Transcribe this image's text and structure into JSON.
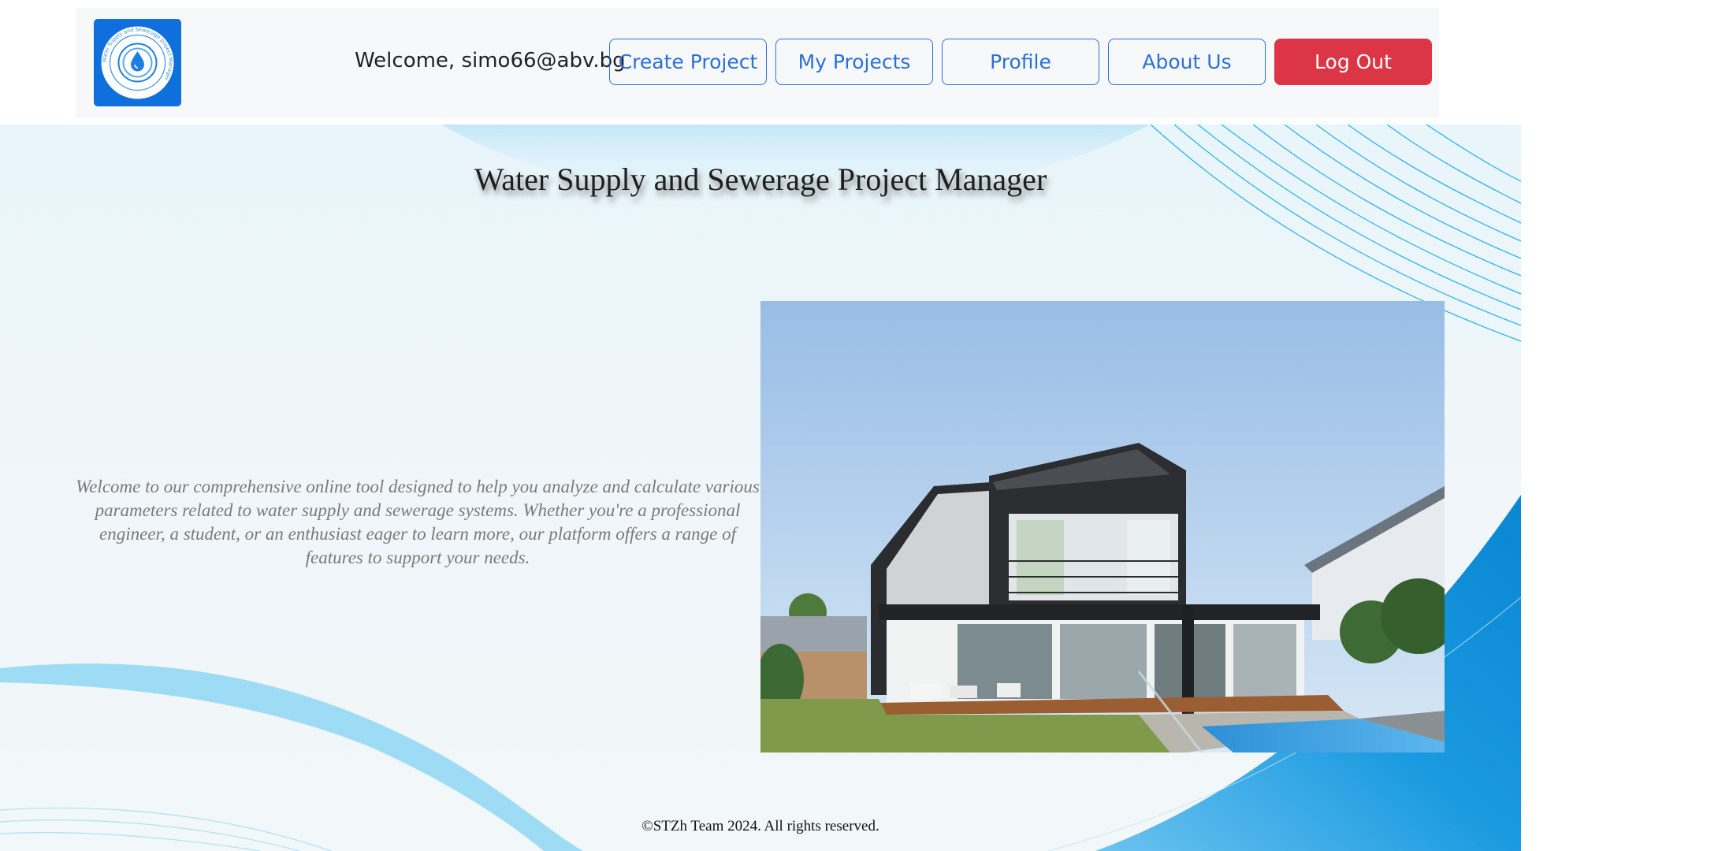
{
  "header": {
    "logo_icon": "water-drop-logo-icon",
    "logo_ring_text": "Water Supply and Sewerage project Manager",
    "welcome_text": "Welcome, simo66@abv.bg",
    "nav": {
      "create_project": "Create Project",
      "my_projects": "My Projects",
      "profile": "Profile",
      "about_us": "About Us",
      "log_out": "Log Out"
    }
  },
  "main": {
    "title": "Water Supply and Sewerage Project Manager",
    "intro": "Welcome to our comprehensive online tool designed to help you analyze and calculate various parameters related to water supply and sewerage systems. Whether you're a professional engineer, a student, or an enthusiast eager to learn more, our platform offers a range of features to support your needs.",
    "hero_image": "modern-house-with-pool-image"
  },
  "footer": {
    "copyright": "©STZh Team 2024. All rights reserved."
  },
  "colors": {
    "primary": "#2b6fdc",
    "danger": "#dc3545",
    "logo_bg": "#0f6fdc",
    "wave_blue": "#0a8ad6"
  }
}
